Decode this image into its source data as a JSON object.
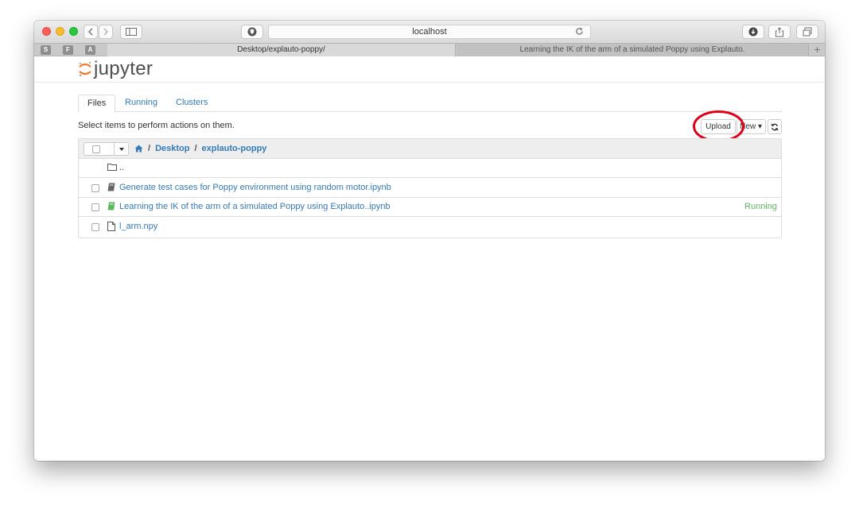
{
  "browser": {
    "address": "localhost",
    "tabs": [
      {
        "title": "Desktop/explauto-poppy/"
      },
      {
        "title": "Learning the IK of the arm of a simulated Poppy using Explauto."
      }
    ],
    "favorites": [
      "S",
      "F",
      "A"
    ]
  },
  "app": {
    "logo_text": "jupyter"
  },
  "nav": {
    "tabs": [
      "Files",
      "Running",
      "Clusters"
    ]
  },
  "instructions": "Select items to perform actions on them.",
  "actions": {
    "upload": "Upload",
    "new": "New",
    "new_caret": "▾"
  },
  "breadcrumb": {
    "items": [
      "Desktop",
      "explauto-poppy"
    ],
    "separator": "/"
  },
  "files": [
    {
      "name": "..",
      "icon": "folder-icon",
      "status": ""
    },
    {
      "name": "Generate test cases for Poppy environment using random motor.ipynb",
      "icon": "notebook-icon",
      "status": ""
    },
    {
      "name": "Learning the IK of the arm of a simulated Poppy using Explauto..ipynb",
      "icon": "notebook-running-icon",
      "status": "Running"
    },
    {
      "name": "l_arm.npy",
      "icon": "file-icon",
      "status": ""
    }
  ],
  "colors": {
    "link": "#337ab7",
    "running": "#5cb85c",
    "annotation": "#e0001a",
    "jupyter_orange": "#f37726"
  }
}
